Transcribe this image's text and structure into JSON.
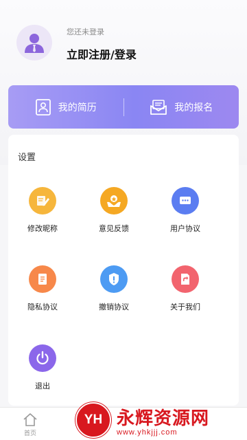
{
  "profile": {
    "status_text": "您还未登录",
    "login_label": "立即注册/登录",
    "avatar_icon": "user-avatar-icon"
  },
  "banner": {
    "resume_label": "我的简历",
    "signup_label": "我的报名",
    "resume_icon": "resume-icon",
    "signup_icon": "mail-icon"
  },
  "settings": {
    "title": "设置",
    "items": [
      {
        "label": "修改昵称",
        "icon": "edit-icon",
        "color": "#f5b43a"
      },
      {
        "label": "意见反馈",
        "icon": "feedback-icon",
        "color": "#f5a623"
      },
      {
        "label": "用户协议",
        "icon": "chat-icon",
        "color": "#5b7cf0"
      },
      {
        "label": "隐私协议",
        "icon": "document-icon",
        "color": "#f7884a"
      },
      {
        "label": "撤销协议",
        "icon": "shield-icon",
        "color": "#4d9bf3"
      },
      {
        "label": "关于我们",
        "icon": "share-icon",
        "color": "#f2646e"
      },
      {
        "label": "退出",
        "icon": "power-icon",
        "color": "#8b67ea"
      }
    ]
  },
  "tabbar": {
    "home_label": "首页"
  },
  "watermark": {
    "logo_text": "YH",
    "title": "永辉资源网",
    "url": "www.yhkjjj.com"
  }
}
